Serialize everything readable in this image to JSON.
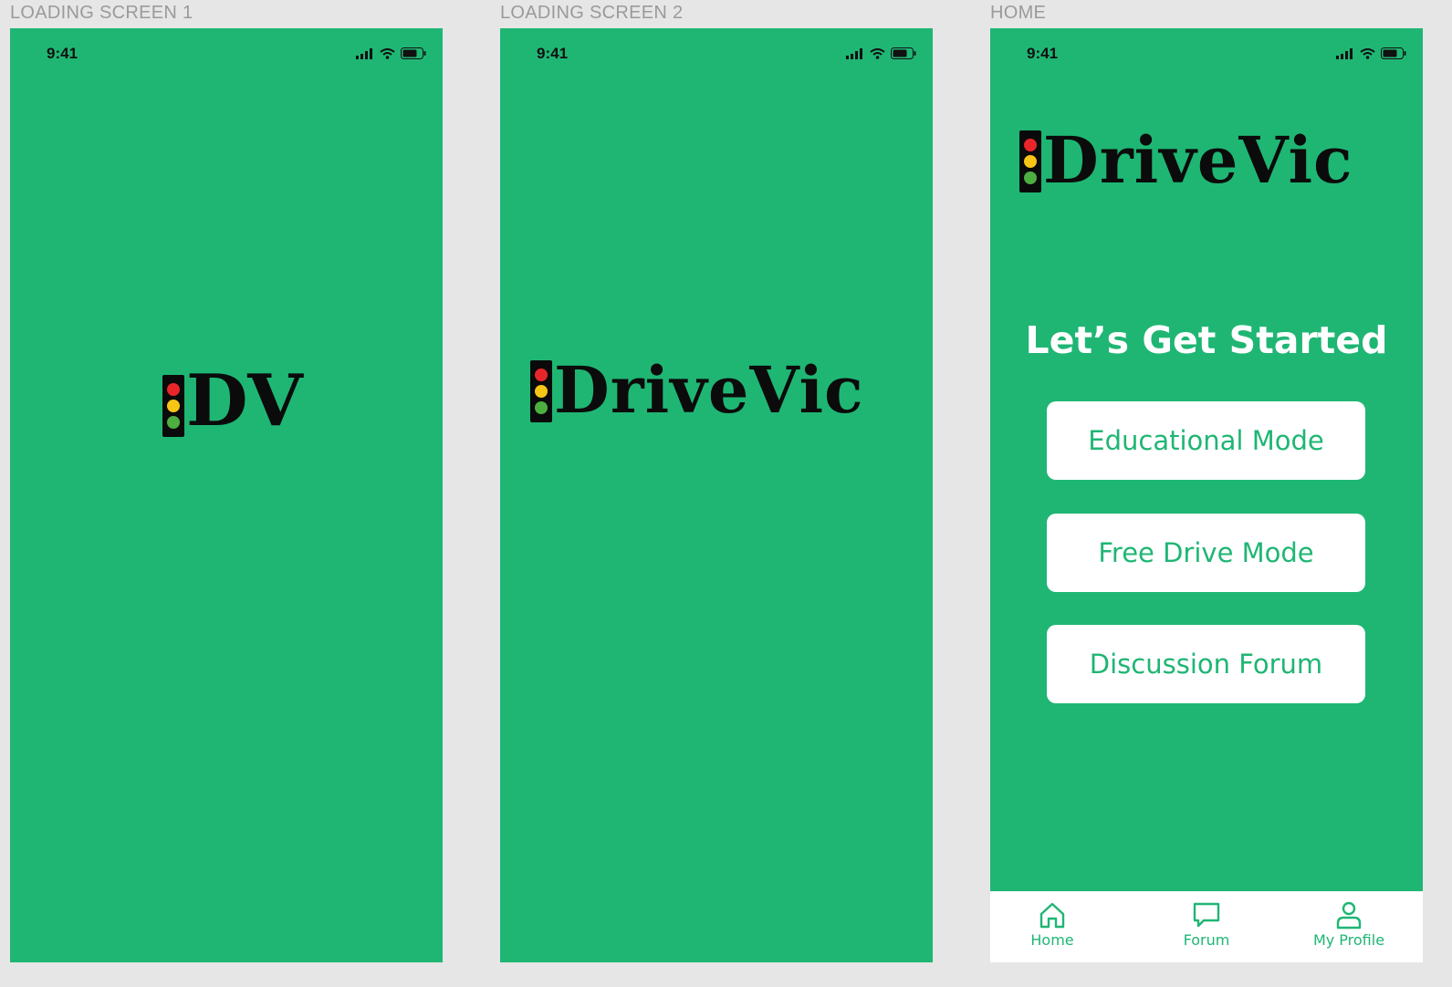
{
  "colors": {
    "brand_green": "#1fb674",
    "canvas_bg": "#e6e6e6",
    "logo_black": "#0b0b0b",
    "light_red": "#e8262a",
    "light_yellow": "#f6c515",
    "light_green": "#4caf40"
  },
  "artboards": [
    {
      "label": "LOADING SCREEN 1",
      "time": "9:41",
      "logo_text": "DV"
    },
    {
      "label": "LOADING SCREEN 2",
      "time": "9:41",
      "logo_text": "DriveVic"
    },
    {
      "label": "HOME",
      "time": "9:41",
      "logo_text": "DriveVic"
    }
  ],
  "home": {
    "heading": "Let’s Get Started",
    "buttons": {
      "educational": "Educational Mode",
      "free_drive": "Free Drive Mode",
      "forum": "Discussion Forum"
    },
    "tabs": {
      "home": "Home",
      "forum": "Forum",
      "profile": "My Profile"
    }
  },
  "icons": {
    "signal": "signal-icon",
    "wifi": "wifi-icon",
    "battery": "battery-icon",
    "home_tab": "house-icon",
    "forum_tab": "chat-bubble-icon",
    "profile_tab": "person-icon"
  }
}
